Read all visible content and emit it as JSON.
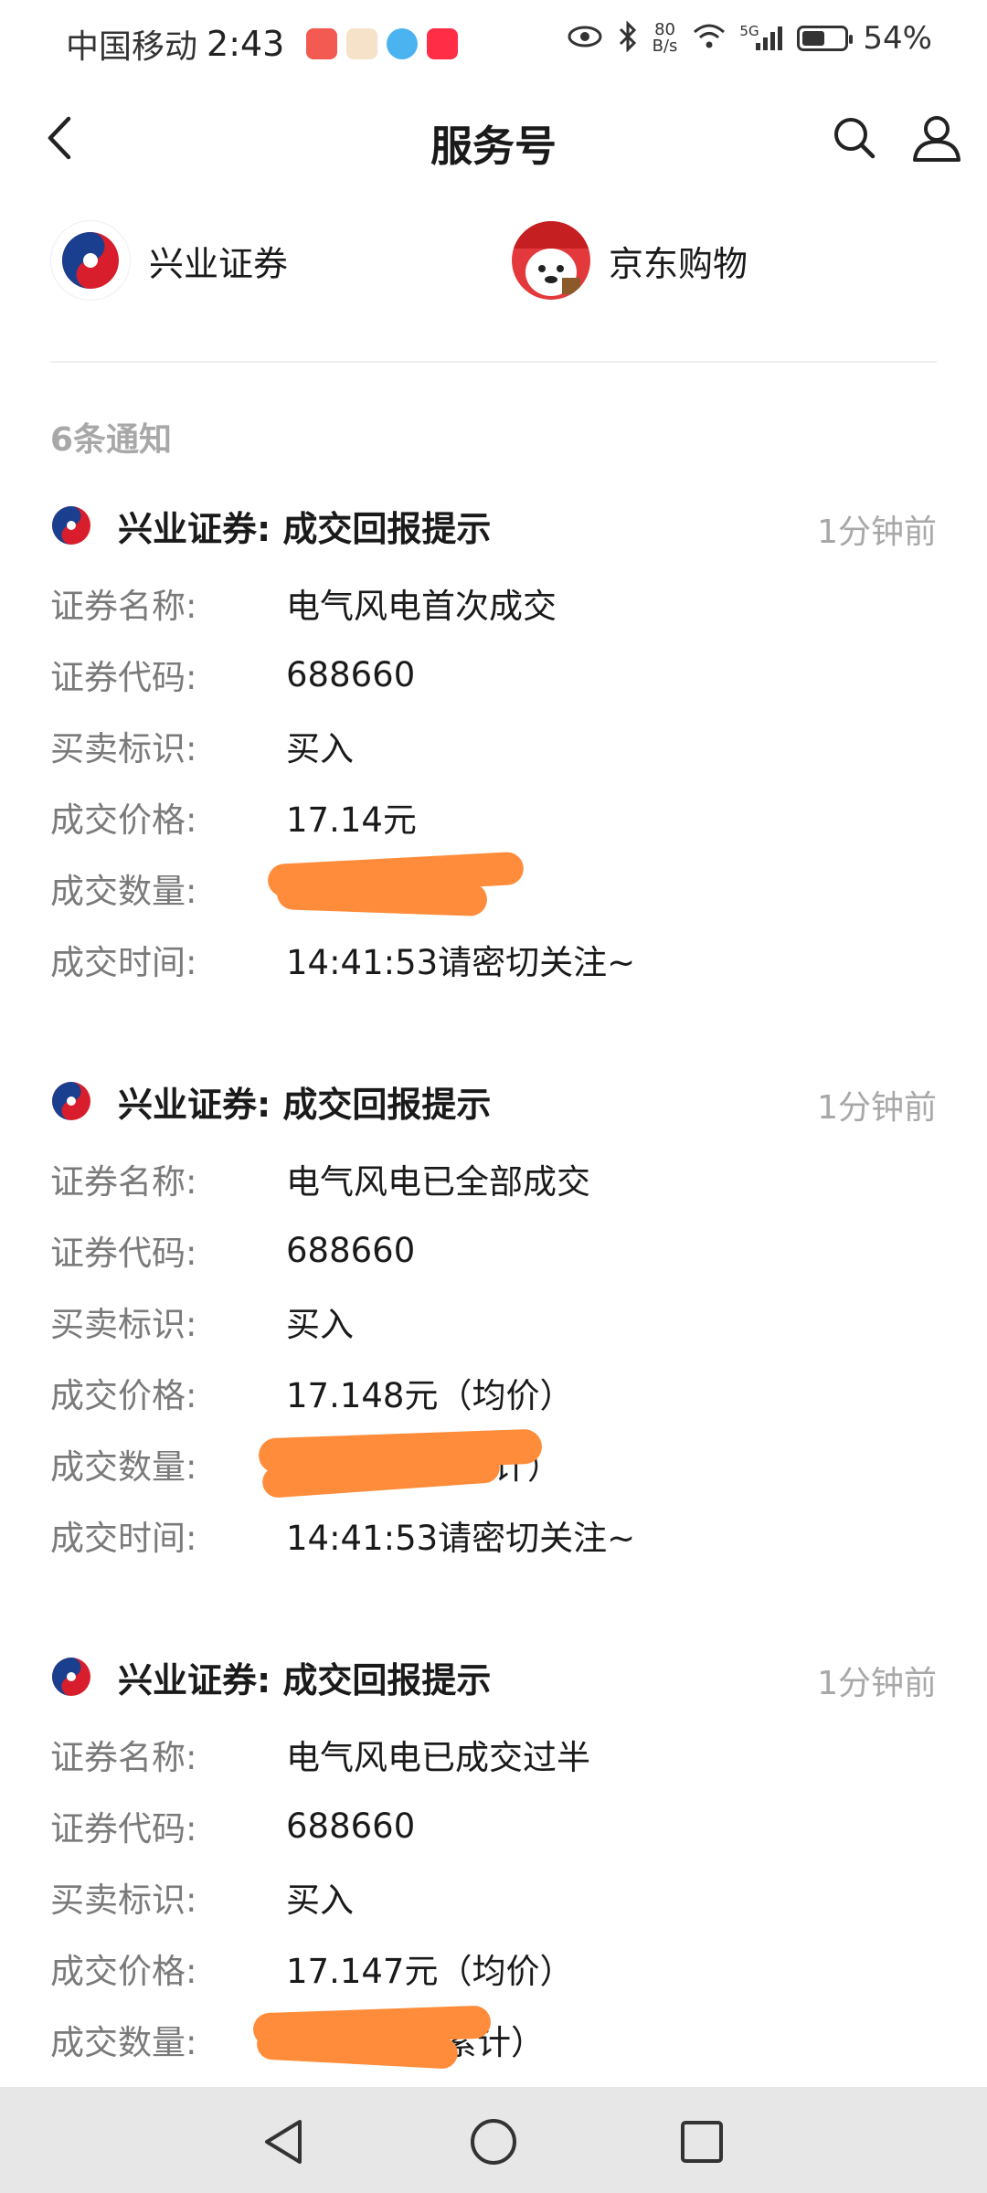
{
  "status_bar": {
    "carrier": "中国移动",
    "time": "2:43",
    "speed_value": "80",
    "speed_unit": "B/s",
    "network": "5G",
    "battery_pct": "54%",
    "battery_level": 0.54
  },
  "header": {
    "title": "服务号"
  },
  "accounts": [
    {
      "name": "兴业证券",
      "logo": "xingye-logo"
    },
    {
      "name": "京东购物",
      "logo": "jd-mascot-logo"
    }
  ],
  "notifications_count": "6条通知",
  "notifications": [
    {
      "title": "兴业证券: 成交回报提示",
      "time": "1分钟前",
      "fields": [
        {
          "label": "证券名称:",
          "value": "电气风电首次成交"
        },
        {
          "label": "证券代码:",
          "value": "688660"
        },
        {
          "label": "买卖标识:",
          "value": "买入"
        },
        {
          "label": "成交价格:",
          "value": "17.14元"
        },
        {
          "label": "成交数量:",
          "value": ""
        },
        {
          "label": "成交时间:",
          "value": "14:41:53请密切关注~"
        }
      ]
    },
    {
      "title": "兴业证券: 成交回报提示",
      "time": "1分钟前",
      "fields": [
        {
          "label": "证券名称:",
          "value": "电气风电已全部成交"
        },
        {
          "label": "证券代码:",
          "value": "688660"
        },
        {
          "label": "买卖标识:",
          "value": "买入"
        },
        {
          "label": "成交价格:",
          "value": "17.148元（均价）"
        },
        {
          "label": "成交数量:",
          "value": "累计）"
        },
        {
          "label": "成交时间:",
          "value": "14:41:53请密切关注~"
        }
      ]
    },
    {
      "title": "兴业证券: 成交回报提示",
      "time": "1分钟前",
      "fields": [
        {
          "label": "证券名称:",
          "value": "电气风电已成交过半"
        },
        {
          "label": "证券代码:",
          "value": "688660"
        },
        {
          "label": "买卖标识:",
          "value": "买入"
        },
        {
          "label": "成交价格:",
          "value": "17.147元（均价）"
        },
        {
          "label": "成交数量:",
          "value": "累计）"
        }
      ]
    }
  ],
  "colors": {
    "redaction": "#ff8c3a",
    "xingye_red": "#d81e2c",
    "xingye_blue": "#1a3f8f",
    "secondary_text": "#a8a8a8",
    "nav_bg": "#e7e7e7"
  },
  "icons": {
    "back": "chevron-left-icon",
    "search": "search-icon",
    "profile": "person-icon",
    "nav_back": "triangle-back-icon",
    "nav_home": "circle-home-icon",
    "nav_recent": "square-recent-icon"
  }
}
